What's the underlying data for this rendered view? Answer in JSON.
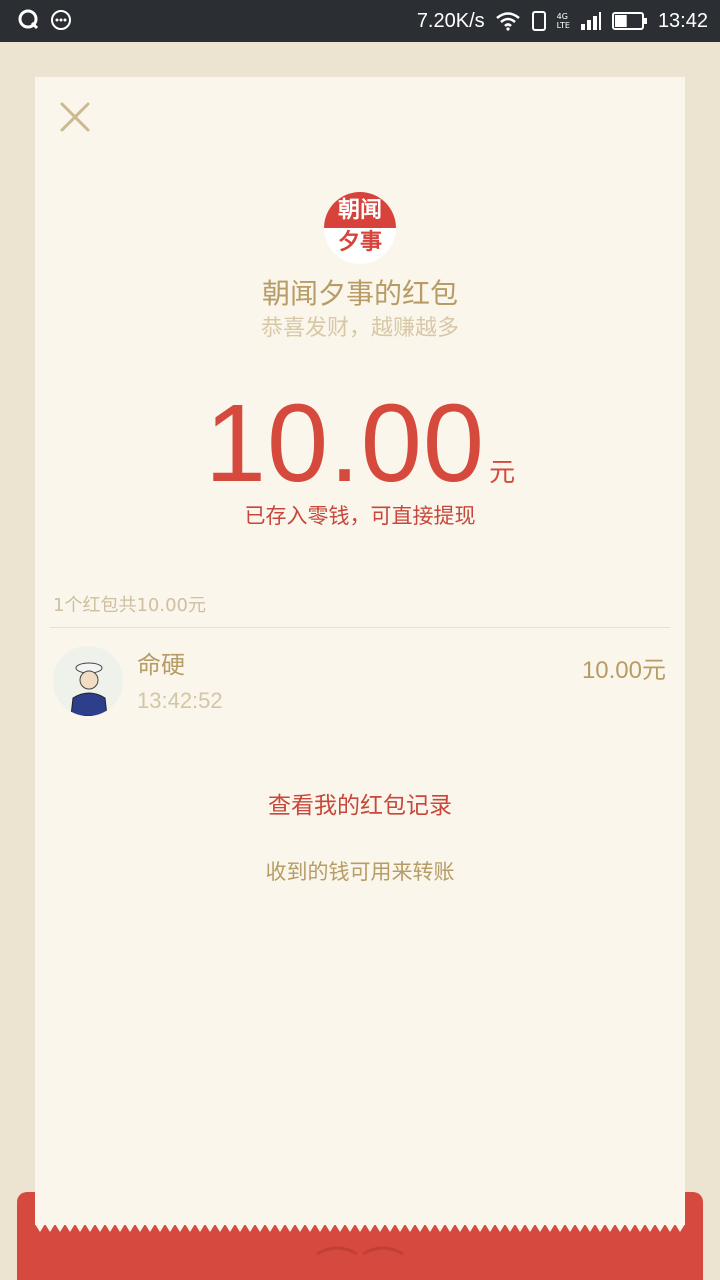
{
  "status_bar": {
    "network_speed": "7.20K/s",
    "network_type_top": "4G",
    "network_type_bottom": "LTE",
    "time": "13:42",
    "battery_level": 0.45
  },
  "header": {
    "logo_top_text": "朝闻",
    "logo_bottom_text": "夕事",
    "sender_title": "朝闻夕事的红包",
    "greeting": "恭喜发财，越赚越多"
  },
  "amount": {
    "value": "10.00",
    "unit": "元",
    "stored_note": "已存入零钱，可直接提现"
  },
  "summary": "1个红包共10.00元",
  "receivers": [
    {
      "name": "命硬",
      "time": "13:42:52",
      "amount": "10.00元"
    }
  ],
  "links": {
    "records": "查看我的红包记录",
    "transfer_tip": "收到的钱可用来转账"
  },
  "colors": {
    "accent_red": "#d64a3d",
    "gold_text": "#b79c66",
    "card_bg": "#faf6ec",
    "page_bg": "#ece3d0"
  }
}
